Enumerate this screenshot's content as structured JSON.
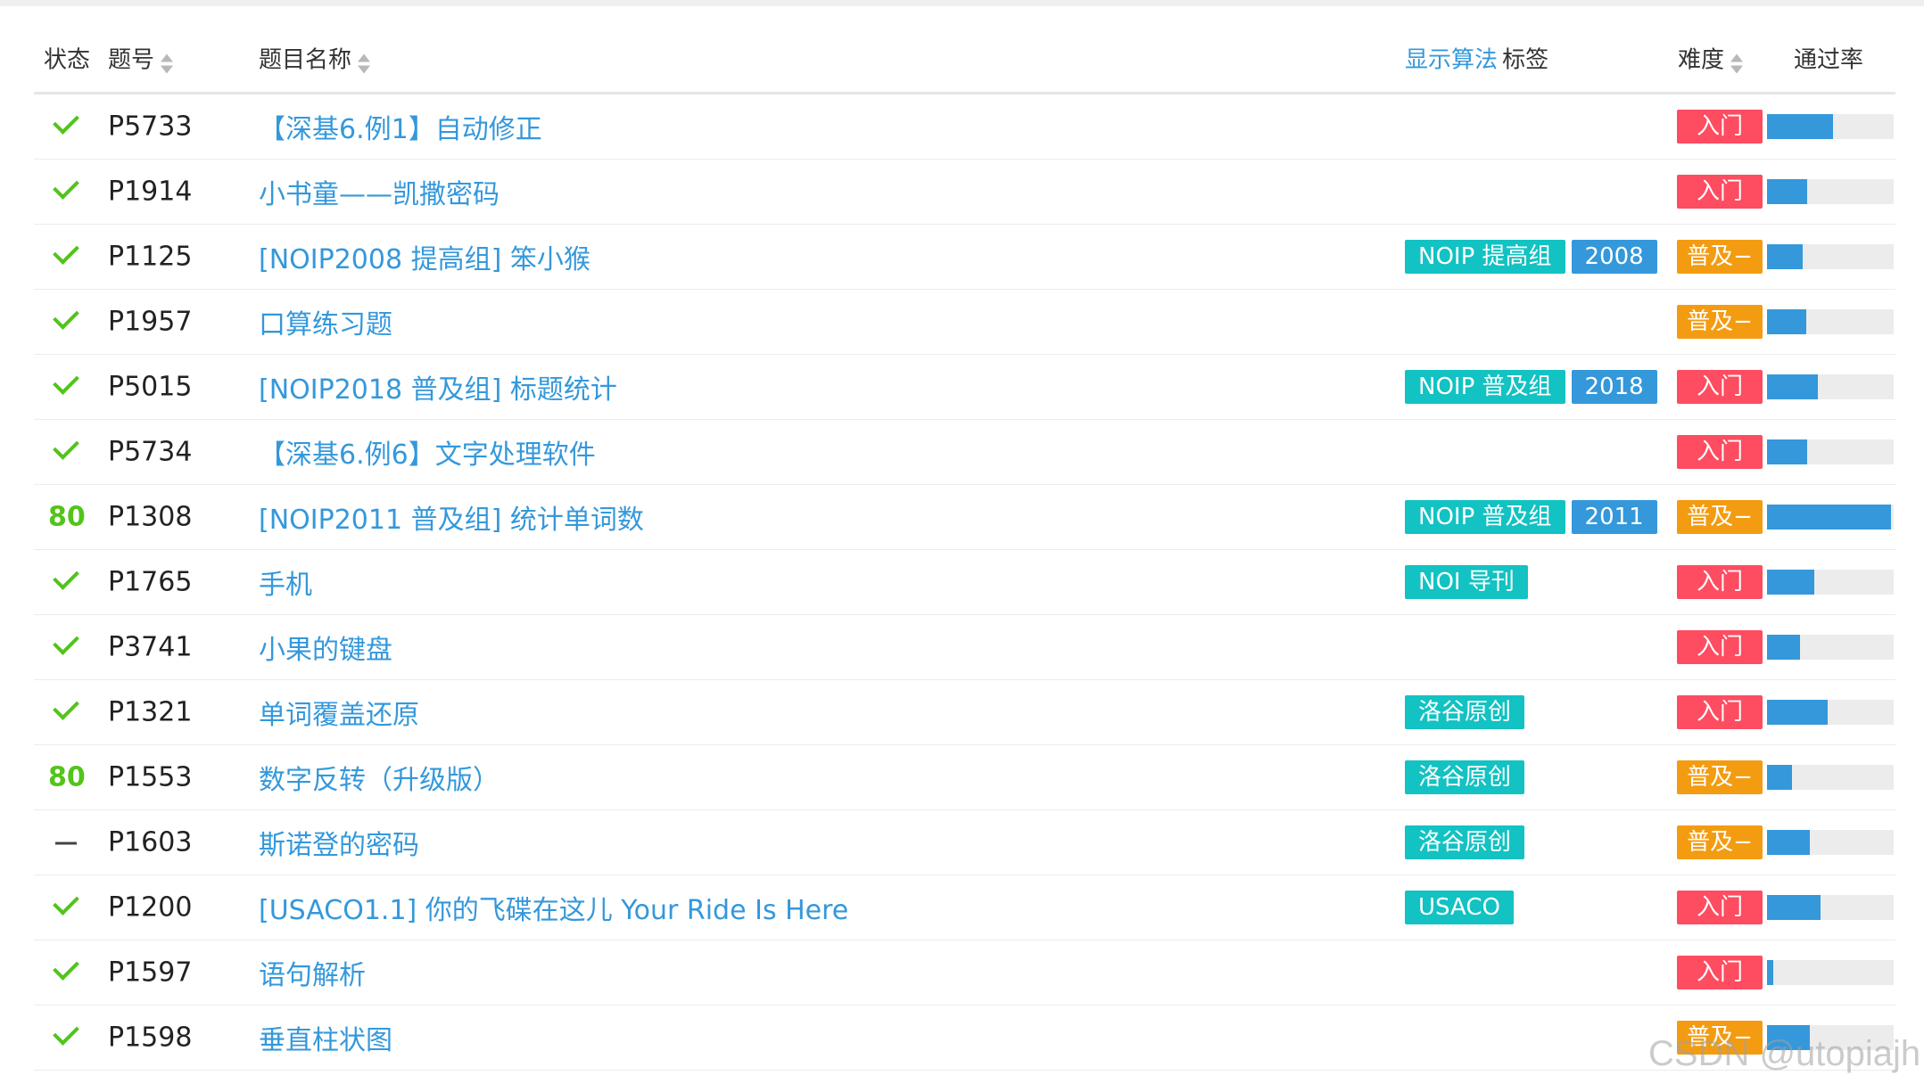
{
  "header": {
    "status": "状态",
    "id": "题号",
    "title": "题目名称",
    "show_algorithms": "显示算法",
    "tags": "标签",
    "difficulty": "难度",
    "pass_rate": "通过率"
  },
  "colors": {
    "accent": "#3498db",
    "success": "#52c41a",
    "tag_teal": "#13c2c2",
    "difficulty_intro": "#fe4c61",
    "difficulty_popular": "#f39c11"
  },
  "rows": [
    {
      "status": "accepted",
      "score": "",
      "id": "P5733",
      "title": "【深基6.例1】自动修正",
      "tags": [],
      "difficulty": "入门",
      "pass_rate": 0.52
    },
    {
      "status": "accepted",
      "score": "",
      "id": "P1914",
      "title": "小书童——凯撒密码",
      "tags": [],
      "difficulty": "入门",
      "pass_rate": 0.32
    },
    {
      "status": "accepted",
      "score": "",
      "id": "P1125",
      "title": "[NOIP2008 提高组] 笨小猴",
      "tags": [
        {
          "text": "NOIP 提高组",
          "color": "teal"
        },
        {
          "text": "2008",
          "color": "blue"
        }
      ],
      "difficulty": "普及−",
      "pass_rate": 0.28
    },
    {
      "status": "accepted",
      "score": "",
      "id": "P1957",
      "title": "口算练习题",
      "tags": [],
      "difficulty": "普及−",
      "pass_rate": 0.31
    },
    {
      "status": "accepted",
      "score": "",
      "id": "P5015",
      "title": "[NOIP2018 普及组] 标题统计",
      "tags": [
        {
          "text": "NOIP 普及组",
          "color": "teal"
        },
        {
          "text": "2018",
          "color": "blue"
        }
      ],
      "difficulty": "入门",
      "pass_rate": 0.4
    },
    {
      "status": "accepted",
      "score": "",
      "id": "P5734",
      "title": "【深基6.例6】文字处理软件",
      "tags": [],
      "difficulty": "入门",
      "pass_rate": 0.32
    },
    {
      "status": "score",
      "score": "80",
      "id": "P1308",
      "title": "[NOIP2011 普及组] 统计单词数",
      "tags": [
        {
          "text": "NOIP 普及组",
          "color": "teal"
        },
        {
          "text": "2011",
          "color": "blue"
        }
      ],
      "difficulty": "普及−",
      "pass_rate": 0.98
    },
    {
      "status": "accepted",
      "score": "",
      "id": "P1765",
      "title": "手机",
      "tags": [
        {
          "text": "NOI 导刊",
          "color": "teal"
        }
      ],
      "difficulty": "入门",
      "pass_rate": 0.37
    },
    {
      "status": "accepted",
      "score": "",
      "id": "P3741",
      "title": "小果的键盘",
      "tags": [],
      "difficulty": "入门",
      "pass_rate": 0.26
    },
    {
      "status": "accepted",
      "score": "",
      "id": "P1321",
      "title": "单词覆盖还原",
      "tags": [
        {
          "text": "洛谷原创",
          "color": "teal"
        }
      ],
      "difficulty": "入门",
      "pass_rate": 0.48
    },
    {
      "status": "score",
      "score": "80",
      "id": "P1553",
      "title": "数字反转（升级版）",
      "tags": [
        {
          "text": "洛谷原创",
          "color": "teal"
        }
      ],
      "difficulty": "普及−",
      "pass_rate": 0.2
    },
    {
      "status": "pending",
      "score": "",
      "id": "P1603",
      "title": "斯诺登的密码",
      "tags": [
        {
          "text": "洛谷原创",
          "color": "teal"
        }
      ],
      "difficulty": "普及−",
      "pass_rate": 0.34
    },
    {
      "status": "accepted",
      "score": "",
      "id": "P1200",
      "title": "[USACO1.1] 你的飞碟在这儿 Your Ride Is Here",
      "tags": [
        {
          "text": "USACO",
          "color": "teal"
        }
      ],
      "difficulty": "入门",
      "pass_rate": 0.42
    },
    {
      "status": "accepted",
      "score": "",
      "id": "P1597",
      "title": "语句解析",
      "tags": [],
      "difficulty": "入门",
      "pass_rate": 0.05
    },
    {
      "status": "accepted",
      "score": "",
      "id": "P1598",
      "title": "垂直柱状图",
      "tags": [],
      "difficulty": "普及−",
      "pass_rate": 0.34
    }
  ],
  "watermark": "CSDN @utopiajh"
}
